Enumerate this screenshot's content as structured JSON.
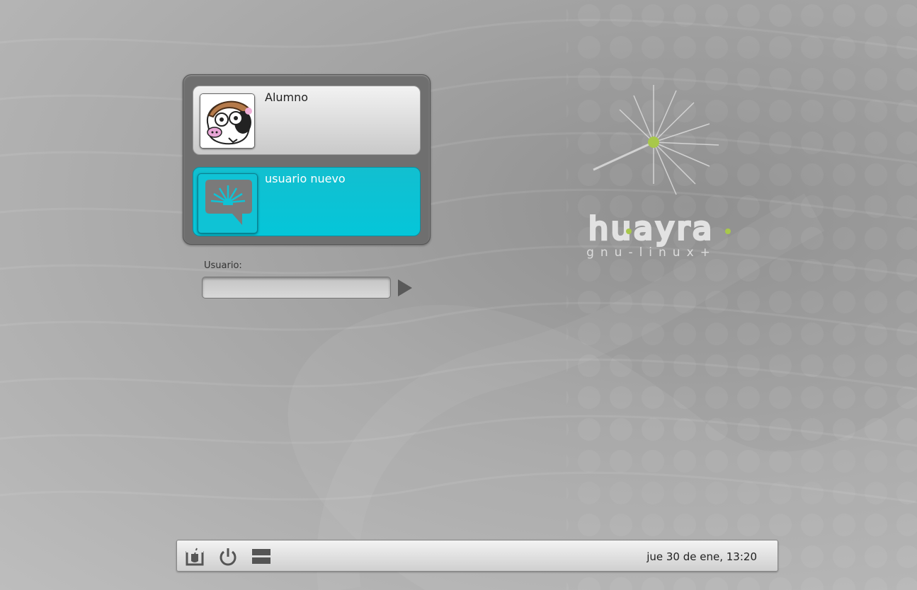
{
  "users": [
    {
      "name": "Alumno",
      "avatar_icon": "cow-avatar-icon",
      "selected": false
    },
    {
      "name": "usuario nuevo",
      "avatar_icon": "default-user-avatar-icon",
      "selected": true
    }
  ],
  "login": {
    "label": "Usuario:",
    "input_value": "",
    "submit_icon": "play-arrow-icon"
  },
  "branding": {
    "logo_text": "huayra",
    "logo_subtext": "gnu-linux+",
    "accent_color": "#a8c84a"
  },
  "bottom_bar": {
    "icons": [
      "accessibility-icon",
      "power-icon",
      "session-menu-icon"
    ],
    "clock": "jue 30 de ene, 13:20"
  },
  "colors": {
    "selected_card": "#05c6d9",
    "panel": "#6f6f6f"
  }
}
